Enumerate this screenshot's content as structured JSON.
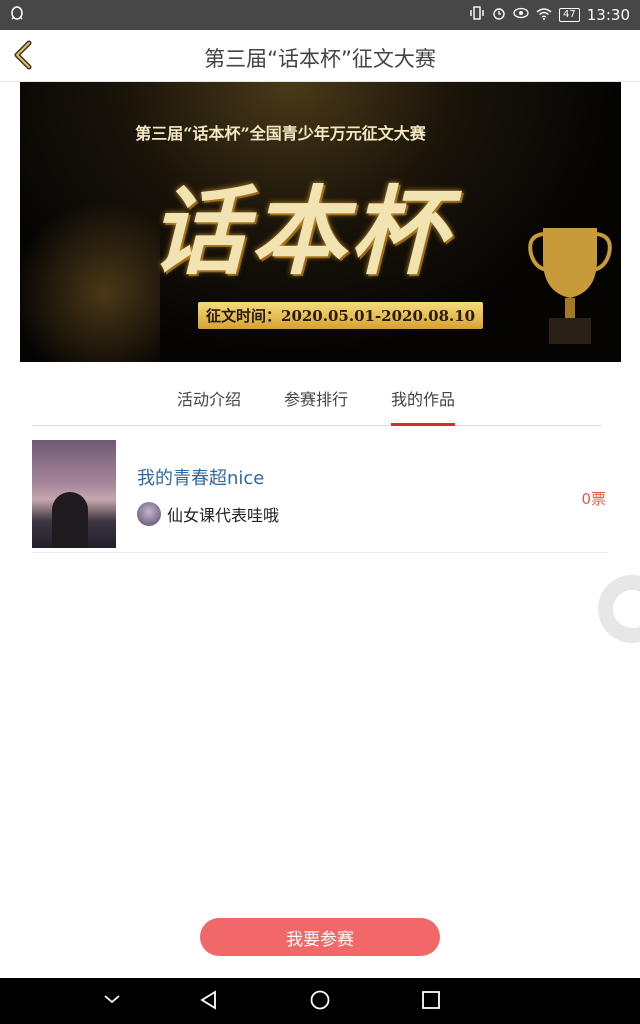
{
  "status_bar": {
    "time": "13:30",
    "battery": "47"
  },
  "header": {
    "title": "第三届“话本杯”征文大赛"
  },
  "banner": {
    "top_text": "第三届“话本杯”全国青少年万元征文大赛",
    "big_text": "话本杯",
    "date_text": "征文时间：2020.05.01-2020.08.10"
  },
  "tabs": [
    {
      "label": "活动介绍"
    },
    {
      "label": "参赛排行"
    },
    {
      "label": "我的作品"
    }
  ],
  "works": [
    {
      "title": "我的青春超nice",
      "author": "仙女课代表哇哦",
      "votes": "0票"
    }
  ],
  "join_button": {
    "label": "我要参赛"
  },
  "colors": {
    "accent": "#d62b2b",
    "button": "#f26767",
    "title_link": "#2f6aa3"
  }
}
